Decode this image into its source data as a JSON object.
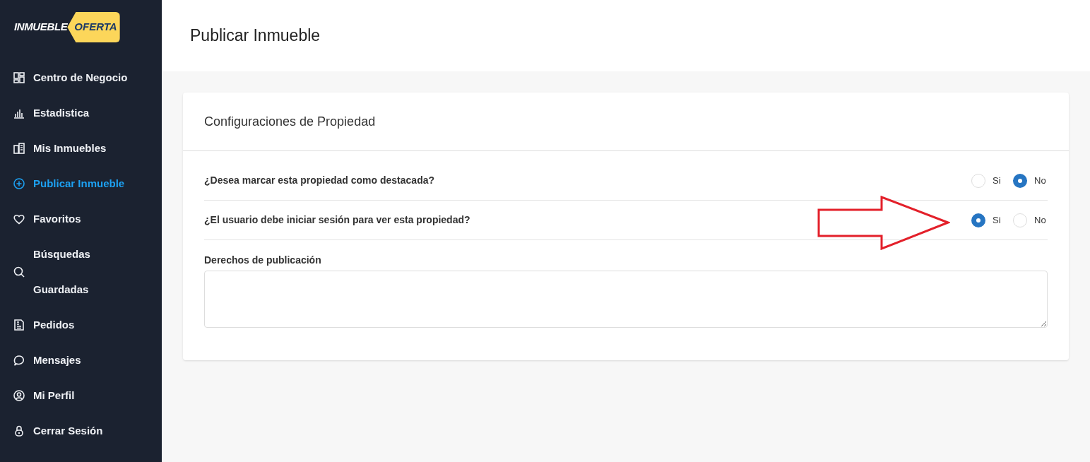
{
  "logo": {
    "left": "INMUEBLE",
    "right": "OFERTA"
  },
  "sidebar": {
    "items": [
      {
        "kind": "dashboard",
        "label": "Centro de Negocio",
        "selected": false
      },
      {
        "kind": "chart",
        "label": "Estadistica",
        "selected": false
      },
      {
        "kind": "building",
        "label": "Mis Inmuebles",
        "selected": false
      },
      {
        "kind": "plus",
        "label": "Publicar Inmueble",
        "selected": true
      },
      {
        "kind": "heart",
        "label": "Favoritos",
        "selected": false
      },
      {
        "kind": "search",
        "label": "Búsquedas Guardadas",
        "selected": false
      },
      {
        "kind": "receipt",
        "label": "Pedidos",
        "selected": false
      },
      {
        "kind": "chat",
        "label": "Mensajes",
        "selected": false
      },
      {
        "kind": "user",
        "label": "Mi Perfil",
        "selected": false
      },
      {
        "kind": "lock",
        "label": "Cerrar Sesión",
        "selected": false
      }
    ]
  },
  "page_title": "Publicar Inmueble",
  "card": {
    "title": "Configuraciones de Propiedad",
    "questions": [
      {
        "label": "¿Desea marcar esta propiedad como destacada?",
        "options": [
          {
            "label": "Si",
            "selected": false
          },
          {
            "label": "No",
            "selected": true
          }
        ]
      },
      {
        "label": "¿El usuario debe iniciar sesión para ver esta propiedad?",
        "options": [
          {
            "label": "Si",
            "selected": true
          },
          {
            "label": "No",
            "selected": false
          }
        ]
      }
    ],
    "textarea": {
      "label": "Derechos de publicación"
    }
  },
  "annotation": {
    "kind": "arrow"
  }
}
